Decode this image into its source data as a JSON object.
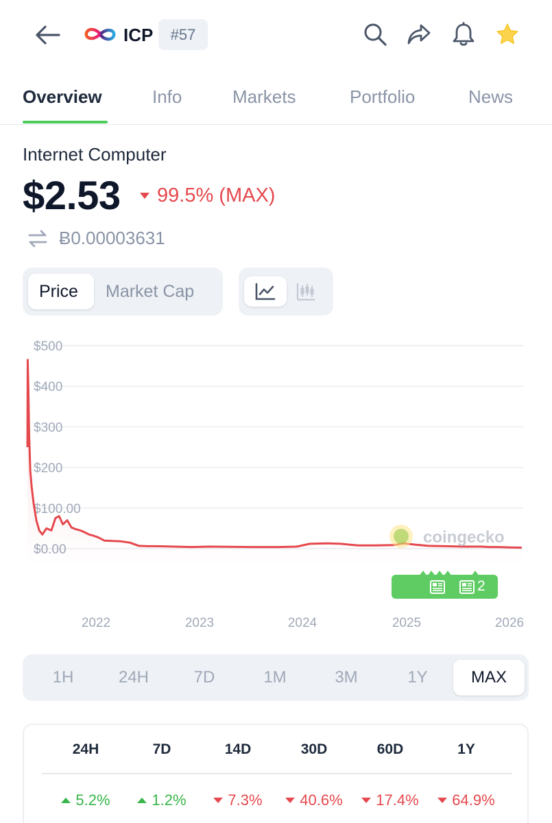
{
  "header": {
    "symbol": "ICP",
    "rank": "#57",
    "icons": [
      "back-arrow-icon",
      "search-icon",
      "share-icon",
      "bell-icon",
      "star-icon"
    ]
  },
  "tabs": [
    {
      "label": "Overview",
      "active": true
    },
    {
      "label": "Info"
    },
    {
      "label": "Markets"
    },
    {
      "label": "Portfolio"
    },
    {
      "label": "News"
    }
  ],
  "coin": {
    "name": "Internet Computer",
    "price": "$2.53",
    "change": "99.5% (MAX)",
    "btc_price": "Ƀ0.00003631"
  },
  "toggles": {
    "price": "Price",
    "market_cap": "Market Cap",
    "selected": "Price"
  },
  "colors": {
    "accent_green": "#4bcc5a",
    "down_red": "#e5484d",
    "up_green": "#39b54a",
    "line_red": "#e5484d"
  },
  "chart_data": {
    "type": "area",
    "y_ticks": [
      "$500",
      "$400",
      "$300",
      "$200",
      "$100.00",
      "$0.00"
    ],
    "y_tick_values": [
      500,
      400,
      300,
      200,
      100,
      0
    ],
    "x_ticks": [
      "2022",
      "2023",
      "2024",
      "2025",
      "2026"
    ],
    "ylim": [
      0,
      500
    ],
    "grid": true,
    "watermark": "coingecko",
    "news_count": "2",
    "series": [
      {
        "x": [
          "2021-05-10",
          "2021-05-11",
          "2021-05-13",
          "2021-05-16",
          "2021-05-20",
          "2021-05-25",
          "2021-06-01",
          "2021-06-10",
          "2021-06-20",
          "2021-07-01",
          "2021-07-15",
          "2021-08-01",
          "2021-08-15",
          "2021-08-28",
          "2021-09-10",
          "2021-09-25",
          "2021-10-10",
          "2021-10-25",
          "2021-11-10",
          "2021-11-25",
          "2021-12-10",
          "2021-12-25",
          "2022-01-10",
          "2022-02-01",
          "2022-03-01",
          "2022-03-30",
          "2022-04-30",
          "2022-06-01",
          "2022-07-01",
          "2022-08-01",
          "2022-10-01",
          "2022-12-01",
          "2023-02-01",
          "2023-04-01",
          "2023-07-01",
          "2023-10-01",
          "2023-12-01",
          "2024-01-15",
          "2024-03-15",
          "2024-05-01",
          "2024-07-01",
          "2024-09-01",
          "2024-11-01",
          "2024-12-05",
          "2025-01-15",
          "2025-03-01",
          "2025-05-01",
          "2025-07-01",
          "2025-09-01",
          "2025-10-01",
          "2025-11-01",
          "2025-12-15",
          "2026-01-20"
        ],
        "values": [
          250,
          465,
          400,
          280,
          190,
          150,
          110,
          70,
          45,
          35,
          50,
          45,
          75,
          80,
          60,
          70,
          52,
          48,
          45,
          40,
          35,
          32,
          28,
          20,
          19,
          18,
          15,
          7,
          6,
          6,
          5,
          4,
          5,
          4.5,
          4,
          4,
          5,
          12,
          13,
          12,
          8,
          8,
          9,
          13,
          10,
          7,
          6,
          5,
          5,
          4,
          4,
          3,
          2.5
        ]
      }
    ]
  },
  "ranges": [
    {
      "label": "1H"
    },
    {
      "label": "24H"
    },
    {
      "label": "7D"
    },
    {
      "label": "1M"
    },
    {
      "label": "3M"
    },
    {
      "label": "1Y"
    },
    {
      "label": "MAX",
      "active": true
    }
  ],
  "performance": [
    {
      "period": "24H",
      "value": "5.2%",
      "direction": "up"
    },
    {
      "period": "7D",
      "value": "1.2%",
      "direction": "up"
    },
    {
      "period": "14D",
      "value": "7.3%",
      "direction": "down"
    },
    {
      "period": "30D",
      "value": "40.6%",
      "direction": "down"
    },
    {
      "period": "60D",
      "value": "17.4%",
      "direction": "down"
    },
    {
      "period": "1Y",
      "value": "64.9%",
      "direction": "down"
    }
  ]
}
